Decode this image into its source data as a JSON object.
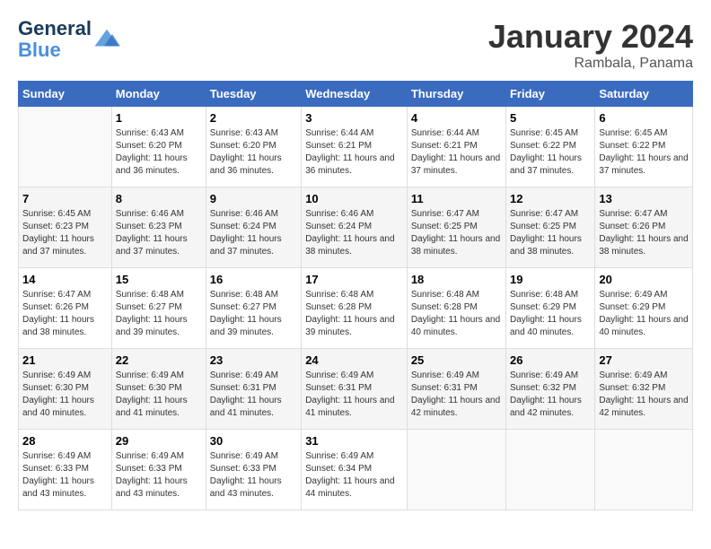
{
  "header": {
    "logo_line1": "General",
    "logo_line2": "Blue",
    "month": "January 2024",
    "location": "Rambala, Panama"
  },
  "columns": [
    "Sunday",
    "Monday",
    "Tuesday",
    "Wednesday",
    "Thursday",
    "Friday",
    "Saturday"
  ],
  "weeks": [
    [
      {
        "day": "",
        "sunrise": "",
        "sunset": "",
        "daylight": ""
      },
      {
        "day": "1",
        "sunrise": "Sunrise: 6:43 AM",
        "sunset": "Sunset: 6:20 PM",
        "daylight": "Daylight: 11 hours and 36 minutes."
      },
      {
        "day": "2",
        "sunrise": "Sunrise: 6:43 AM",
        "sunset": "Sunset: 6:20 PM",
        "daylight": "Daylight: 11 hours and 36 minutes."
      },
      {
        "day": "3",
        "sunrise": "Sunrise: 6:44 AM",
        "sunset": "Sunset: 6:21 PM",
        "daylight": "Daylight: 11 hours and 36 minutes."
      },
      {
        "day": "4",
        "sunrise": "Sunrise: 6:44 AM",
        "sunset": "Sunset: 6:21 PM",
        "daylight": "Daylight: 11 hours and 37 minutes."
      },
      {
        "day": "5",
        "sunrise": "Sunrise: 6:45 AM",
        "sunset": "Sunset: 6:22 PM",
        "daylight": "Daylight: 11 hours and 37 minutes."
      },
      {
        "day": "6",
        "sunrise": "Sunrise: 6:45 AM",
        "sunset": "Sunset: 6:22 PM",
        "daylight": "Daylight: 11 hours and 37 minutes."
      }
    ],
    [
      {
        "day": "7",
        "sunrise": "Sunrise: 6:45 AM",
        "sunset": "Sunset: 6:23 PM",
        "daylight": "Daylight: 11 hours and 37 minutes."
      },
      {
        "day": "8",
        "sunrise": "Sunrise: 6:46 AM",
        "sunset": "Sunset: 6:23 PM",
        "daylight": "Daylight: 11 hours and 37 minutes."
      },
      {
        "day": "9",
        "sunrise": "Sunrise: 6:46 AM",
        "sunset": "Sunset: 6:24 PM",
        "daylight": "Daylight: 11 hours and 37 minutes."
      },
      {
        "day": "10",
        "sunrise": "Sunrise: 6:46 AM",
        "sunset": "Sunset: 6:24 PM",
        "daylight": "Daylight: 11 hours and 38 minutes."
      },
      {
        "day": "11",
        "sunrise": "Sunrise: 6:47 AM",
        "sunset": "Sunset: 6:25 PM",
        "daylight": "Daylight: 11 hours and 38 minutes."
      },
      {
        "day": "12",
        "sunrise": "Sunrise: 6:47 AM",
        "sunset": "Sunset: 6:25 PM",
        "daylight": "Daylight: 11 hours and 38 minutes."
      },
      {
        "day": "13",
        "sunrise": "Sunrise: 6:47 AM",
        "sunset": "Sunset: 6:26 PM",
        "daylight": "Daylight: 11 hours and 38 minutes."
      }
    ],
    [
      {
        "day": "14",
        "sunrise": "Sunrise: 6:47 AM",
        "sunset": "Sunset: 6:26 PM",
        "daylight": "Daylight: 11 hours and 38 minutes."
      },
      {
        "day": "15",
        "sunrise": "Sunrise: 6:48 AM",
        "sunset": "Sunset: 6:27 PM",
        "daylight": "Daylight: 11 hours and 39 minutes."
      },
      {
        "day": "16",
        "sunrise": "Sunrise: 6:48 AM",
        "sunset": "Sunset: 6:27 PM",
        "daylight": "Daylight: 11 hours and 39 minutes."
      },
      {
        "day": "17",
        "sunrise": "Sunrise: 6:48 AM",
        "sunset": "Sunset: 6:28 PM",
        "daylight": "Daylight: 11 hours and 39 minutes."
      },
      {
        "day": "18",
        "sunrise": "Sunrise: 6:48 AM",
        "sunset": "Sunset: 6:28 PM",
        "daylight": "Daylight: 11 hours and 40 minutes."
      },
      {
        "day": "19",
        "sunrise": "Sunrise: 6:48 AM",
        "sunset": "Sunset: 6:29 PM",
        "daylight": "Daylight: 11 hours and 40 minutes."
      },
      {
        "day": "20",
        "sunrise": "Sunrise: 6:49 AM",
        "sunset": "Sunset: 6:29 PM",
        "daylight": "Daylight: 11 hours and 40 minutes."
      }
    ],
    [
      {
        "day": "21",
        "sunrise": "Sunrise: 6:49 AM",
        "sunset": "Sunset: 6:30 PM",
        "daylight": "Daylight: 11 hours and 40 minutes."
      },
      {
        "day": "22",
        "sunrise": "Sunrise: 6:49 AM",
        "sunset": "Sunset: 6:30 PM",
        "daylight": "Daylight: 11 hours and 41 minutes."
      },
      {
        "day": "23",
        "sunrise": "Sunrise: 6:49 AM",
        "sunset": "Sunset: 6:31 PM",
        "daylight": "Daylight: 11 hours and 41 minutes."
      },
      {
        "day": "24",
        "sunrise": "Sunrise: 6:49 AM",
        "sunset": "Sunset: 6:31 PM",
        "daylight": "Daylight: 11 hours and 41 minutes."
      },
      {
        "day": "25",
        "sunrise": "Sunrise: 6:49 AM",
        "sunset": "Sunset: 6:31 PM",
        "daylight": "Daylight: 11 hours and 42 minutes."
      },
      {
        "day": "26",
        "sunrise": "Sunrise: 6:49 AM",
        "sunset": "Sunset: 6:32 PM",
        "daylight": "Daylight: 11 hours and 42 minutes."
      },
      {
        "day": "27",
        "sunrise": "Sunrise: 6:49 AM",
        "sunset": "Sunset: 6:32 PM",
        "daylight": "Daylight: 11 hours and 42 minutes."
      }
    ],
    [
      {
        "day": "28",
        "sunrise": "Sunrise: 6:49 AM",
        "sunset": "Sunset: 6:33 PM",
        "daylight": "Daylight: 11 hours and 43 minutes."
      },
      {
        "day": "29",
        "sunrise": "Sunrise: 6:49 AM",
        "sunset": "Sunset: 6:33 PM",
        "daylight": "Daylight: 11 hours and 43 minutes."
      },
      {
        "day": "30",
        "sunrise": "Sunrise: 6:49 AM",
        "sunset": "Sunset: 6:33 PM",
        "daylight": "Daylight: 11 hours and 43 minutes."
      },
      {
        "day": "31",
        "sunrise": "Sunrise: 6:49 AM",
        "sunset": "Sunset: 6:34 PM",
        "daylight": "Daylight: 11 hours and 44 minutes."
      },
      {
        "day": "",
        "sunrise": "",
        "sunset": "",
        "daylight": ""
      },
      {
        "day": "",
        "sunrise": "",
        "sunset": "",
        "daylight": ""
      },
      {
        "day": "",
        "sunrise": "",
        "sunset": "",
        "daylight": ""
      }
    ]
  ]
}
